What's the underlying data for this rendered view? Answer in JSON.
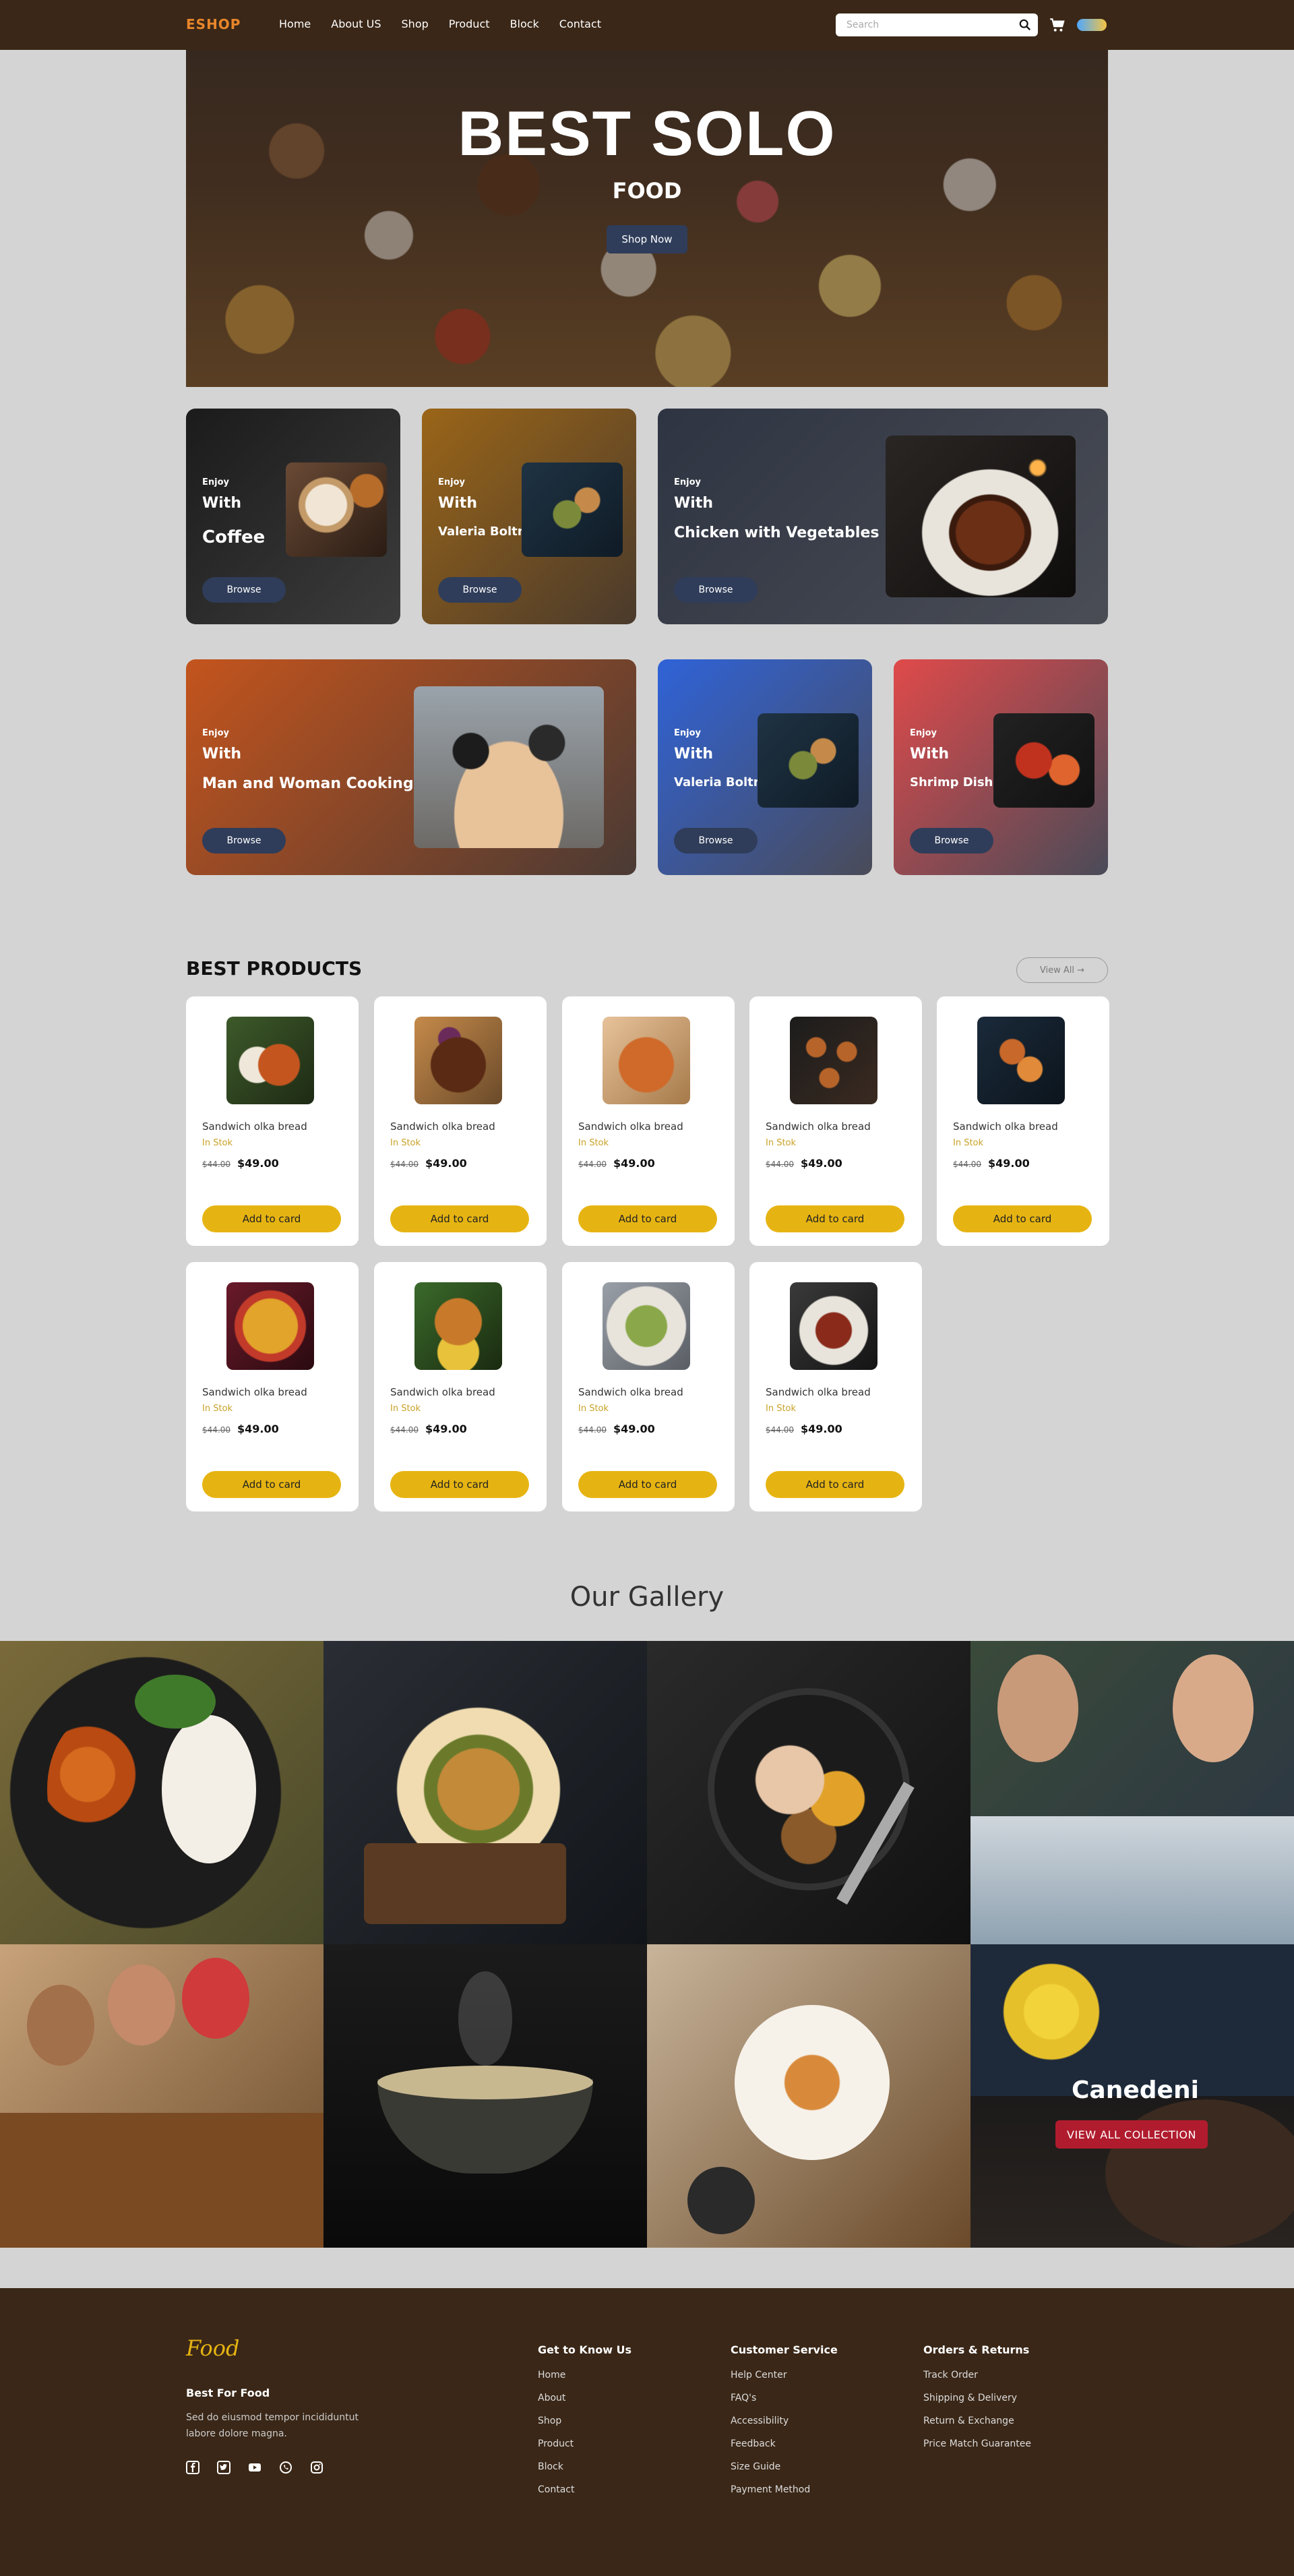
{
  "nav": {
    "logo": "ESHOP",
    "links": [
      "Home",
      "About US",
      "Shop",
      "Product",
      "Block",
      "Contact"
    ],
    "search_placeholder": "Search"
  },
  "hero": {
    "title": "BEST SOLO",
    "subtitle": "FOOD",
    "button": "Shop Now"
  },
  "promos": [
    {
      "enjoy": "Enjoy",
      "with": "With",
      "name": "Coffee",
      "button": "Browse"
    },
    {
      "enjoy": "Enjoy",
      "with": "With",
      "name": "Valeria Boltneva",
      "button": "Browse"
    },
    {
      "enjoy": "Enjoy",
      "with": "With",
      "name": "Chicken with Vegetables",
      "button": "Browse"
    },
    {
      "enjoy": "Enjoy",
      "with": "With",
      "name": "Man and Woman Cooking",
      "button": "Browse"
    },
    {
      "enjoy": "Enjoy",
      "with": "With",
      "name": "Valeria Boltneva",
      "button": "Browse"
    },
    {
      "enjoy": "Enjoy",
      "with": "With",
      "name": "Shrimp Dish",
      "button": "Browse"
    }
  ],
  "products": {
    "title": "BEST PRODUCTS",
    "view_all": "View All",
    "items": [
      {
        "name": "Sandwich olka bread",
        "stock": "In Stok",
        "old_price": "$44.00",
        "price": "$49.00",
        "button": "Add to card"
      },
      {
        "name": "Sandwich olka bread",
        "stock": "In Stok",
        "old_price": "$44.00",
        "price": "$49.00",
        "button": "Add to card"
      },
      {
        "name": "Sandwich olka bread",
        "stock": "In Stok",
        "old_price": "$44.00",
        "price": "$49.00",
        "button": "Add to card"
      },
      {
        "name": "Sandwich olka bread",
        "stock": "In Stok",
        "old_price": "$44.00",
        "price": "$49.00",
        "button": "Add to card"
      },
      {
        "name": "Sandwich olka bread",
        "stock": "In Stok",
        "old_price": "$44.00",
        "price": "$49.00",
        "button": "Add to card"
      },
      {
        "name": "Sandwich olka bread",
        "stock": "In Stok",
        "old_price": "$44.00",
        "price": "$49.00",
        "button": "Add to card"
      },
      {
        "name": "Sandwich olka bread",
        "stock": "In Stok",
        "old_price": "$44.00",
        "price": "$49.00",
        "button": "Add to card"
      },
      {
        "name": "Sandwich olka bread",
        "stock": "In Stok",
        "old_price": "$44.00",
        "price": "$49.00",
        "button": "Add to card"
      },
      {
        "name": "Sandwich olka bread",
        "stock": "In Stok",
        "old_price": "$44.00",
        "price": "$49.00",
        "button": "Add to card"
      }
    ]
  },
  "gallery": {
    "title": "Our Gallery",
    "caption": "Canedeni",
    "button": "VIEW ALL COLLECTION"
  },
  "footer": {
    "logo": "Food",
    "tagline": "Best For Food",
    "description": "Sed do eiusmod tempor incididuntut labore dolore magna.",
    "columns": [
      {
        "title": "Get to Know Us",
        "links": [
          "Home",
          "About",
          "Shop",
          "Product",
          "Block",
          "Contact"
        ]
      },
      {
        "title": "Customer Service",
        "links": [
          "Help Center",
          "FAQ's",
          "Accessibility",
          "Feedback",
          "Size Guide",
          "Payment Method"
        ]
      },
      {
        "title": "Orders & Returns",
        "links": [
          "Track Order",
          "Shipping & Delivery",
          "Return & Exchange",
          "Price Match Guarantee"
        ]
      }
    ]
  }
}
